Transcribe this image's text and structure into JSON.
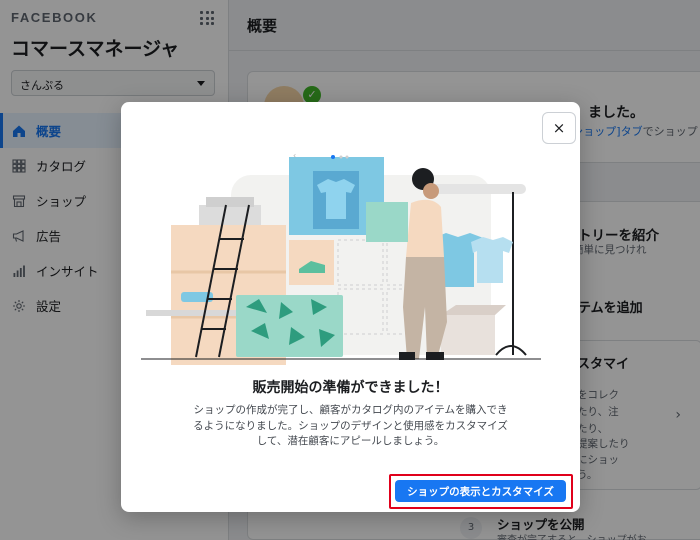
{
  "sidebar": {
    "brand": "FACEBOOK",
    "title": "コマースマネージャ",
    "account_select": "さんぷる",
    "items": [
      {
        "label": "概要",
        "icon": "home-icon",
        "active": true
      },
      {
        "label": "カタログ",
        "icon": "grid-icon"
      },
      {
        "label": "ショップ",
        "icon": "storefront-icon"
      },
      {
        "label": "広告",
        "icon": "megaphone-icon"
      },
      {
        "label": "インサイト",
        "icon": "bar-chart-icon"
      },
      {
        "label": "設定",
        "icon": "gear-icon"
      }
    ]
  },
  "main": {
    "title": "概要",
    "card1": {
      "title": "ました。",
      "sub_link": "[ショップ]タブ",
      "sub_rest": "でショップ"
    },
    "card2": {
      "heading1": "トリーを紹介",
      "sub1": "簡単に見つけれ",
      "heading2": "テムを追加",
      "box_title": "スタマイ",
      "box_lines": [
        "をコレク",
        "たり、注",
        "たり、",
        "提案したり",
        "にショッ",
        "う。"
      ],
      "step_number": "3",
      "step_title": "ショップを公開",
      "step_sub": "審査が完了すると、ショップがお"
    }
  },
  "modal": {
    "title": "販売開始の準備ができました！",
    "body_lines": [
      "ショップの作成が完了し、顧客がカタログ内のアイテムを購入でき",
      "るようになりました。ショップのデザインと使用感をカスタマイズ",
      "して、潜在顧客にアピールしましょう。"
    ],
    "close_label": "×",
    "cta_label": "ショップの表示とカスタマイズ"
  },
  "colors": {
    "accent": "#1877f2",
    "highlight_border": "#e0001b"
  }
}
